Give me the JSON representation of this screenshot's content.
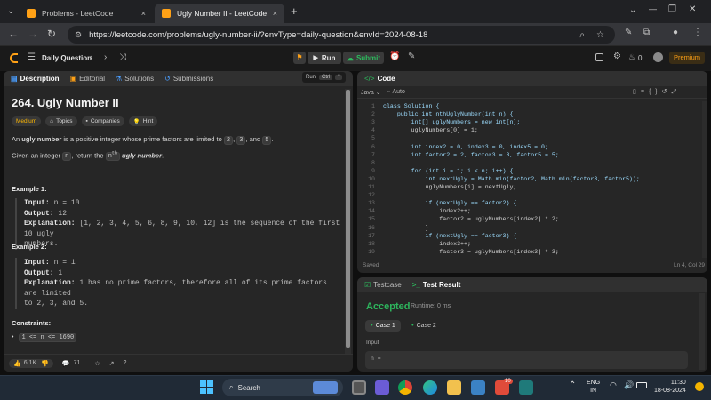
{
  "browser": {
    "tabs": [
      {
        "title": "Problems - LeetCode",
        "close": "×"
      },
      {
        "title": "Ugly Number II - LeetCode",
        "close": "×"
      }
    ],
    "new_tab": "+",
    "url": "https://leetcode.com/problems/ugly-number-ii/?envType=daily-question&envId=2024-08-18",
    "window_controls": [
      "⌄",
      "—",
      "❐",
      "✕"
    ]
  },
  "lcnav": {
    "daily": "Daily Question",
    "run": "Run",
    "submit": "Submit",
    "fire_count": "0",
    "premium": "Premium"
  },
  "left": {
    "tabs": [
      "Description",
      "Editorial",
      "Solutions",
      "Submissions"
    ],
    "run_hint": "Run",
    "run_hint_key": "Ctrl",
    "title": "264. Ugly Number II",
    "difficulty": "Medium",
    "chips": [
      "Topics",
      "Companies",
      "Hint"
    ],
    "desc1_pre": "An ",
    "desc1_b": "ugly number",
    "desc1_mid": " is a positive integer whose prime factors are limited to ",
    "p2": "2",
    "comma": ", ",
    "p3": "3",
    "and": ", and ",
    "p5": "5",
    "dot": ".",
    "desc2_pre": "Given an integer ",
    "n": "n",
    "desc2_mid": ", return the ",
    "nth": "n",
    "th": "th",
    "desc2_b": " ugly number",
    "desc2_end": ".",
    "ex1_title": "Example 1:",
    "ex1_input_l": "Input:",
    "ex1_input": " n = 10",
    "ex1_output_l": "Output:",
    "ex1_output": " 12",
    "ex1_expl_l": "Explanation:",
    "ex1_expl": " [1, 2, 3, 4, 5, 6, 8, 9, 10, 12] is the sequence of the first 10 ugly",
    "ex1_expl2": "numbers.",
    "ex2_title": "Example 2:",
    "ex2_input_l": "Input:",
    "ex2_input": " n = 1",
    "ex2_output_l": "Output:",
    "ex2_output": " 1",
    "ex2_expl_l": "Explanation:",
    "ex2_expl": " 1 has no prime factors, therefore all of its prime factors are limited",
    "ex2_expl2": "to 2, 3, and 5.",
    "constraints_title": "Constraints:",
    "constraint": "1 <= n <= 1690",
    "likes": "6.1K",
    "comments": "71"
  },
  "code": {
    "title": "Code",
    "lang": "Java",
    "mode": "Auto",
    "lines": [
      {
        "n": "1",
        "t": "class Solution {"
      },
      {
        "n": "2",
        "t": "    public int nthUglyNumber(int n) {"
      },
      {
        "n": "3",
        "t": "        int[] uglyNumbers = new int[n];"
      },
      {
        "n": "4",
        "t": "        uglyNumbers[0] = 1;"
      },
      {
        "n": "5",
        "t": ""
      },
      {
        "n": "6",
        "t": "        int index2 = 0, index3 = 0, index5 = 0;"
      },
      {
        "n": "7",
        "t": "        int factor2 = 2, factor3 = 3, factor5 = 5;"
      },
      {
        "n": "8",
        "t": ""
      },
      {
        "n": "9",
        "t": "        for (int i = 1; i < n; i++) {"
      },
      {
        "n": "10",
        "t": "            int nextUgly = Math.min(factor2, Math.min(factor3, factor5));"
      },
      {
        "n": "11",
        "t": "            uglyNumbers[i] = nextUgly;"
      },
      {
        "n": "12",
        "t": ""
      },
      {
        "n": "13",
        "t": "            if (nextUgly == factor2) {"
      },
      {
        "n": "14",
        "t": "                index2++;"
      },
      {
        "n": "15",
        "t": "                factor2 = uglyNumbers[index2] * 2;"
      },
      {
        "n": "16",
        "t": "            }"
      },
      {
        "n": "17",
        "t": "            if (nextUgly == factor3) {"
      },
      {
        "n": "18",
        "t": "                index3++;"
      },
      {
        "n": "19",
        "t": "                factor3 = uglyNumbers[index3] * 3;"
      }
    ],
    "saved": "Saved",
    "cursor": "Ln 4, Col 29"
  },
  "result": {
    "tab1": "Testcase",
    "tab2": "Test Result",
    "status": "Accepted",
    "runtime": "Runtime: 0 ms",
    "cases": [
      "Case 1",
      "Case 2"
    ],
    "input_label": "Input",
    "input_value": "n ="
  },
  "taskbar": {
    "search": "Search",
    "lang1": "ENG",
    "lang2": "IN",
    "time": "11:30",
    "date": "18-08-2024",
    "badge": "10"
  },
  "colors": {
    "accent": "#ffa116",
    "green": "#2cbb5d",
    "premium": "#ffa116",
    "accepted": "#2db55d"
  }
}
